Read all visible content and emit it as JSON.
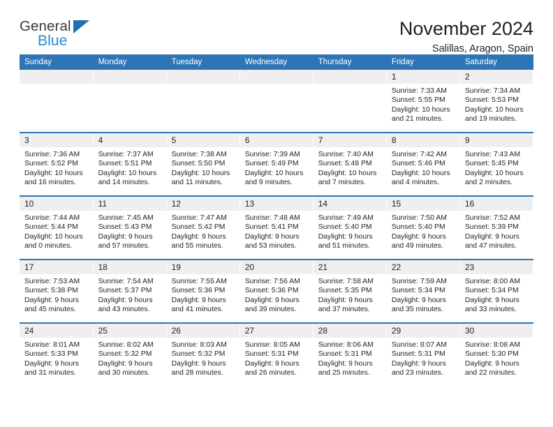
{
  "brand": {
    "name_part1": "General",
    "name_part2": "Blue",
    "triangle_icon": "blue-triangle-icon",
    "accent_color": "#1f8ad6",
    "triangle_color": "#1f6fb5"
  },
  "header": {
    "title": "November 2024",
    "subtitle": "Salillas, Aragon, Spain"
  },
  "theme": {
    "header_row_bg": "#2e75b6",
    "header_row_text": "#ffffff",
    "daynum_bg": "#efefef",
    "cell_bg": "#ffffff",
    "text_color": "#231f20"
  },
  "calendar": {
    "weekday_headers": [
      "Sunday",
      "Monday",
      "Tuesday",
      "Wednesday",
      "Thursday",
      "Friday",
      "Saturday"
    ],
    "weeks": [
      [
        {
          "day": "",
          "sunrise": "",
          "sunset": "",
          "daylight": ""
        },
        {
          "day": "",
          "sunrise": "",
          "sunset": "",
          "daylight": ""
        },
        {
          "day": "",
          "sunrise": "",
          "sunset": "",
          "daylight": ""
        },
        {
          "day": "",
          "sunrise": "",
          "sunset": "",
          "daylight": ""
        },
        {
          "day": "",
          "sunrise": "",
          "sunset": "",
          "daylight": ""
        },
        {
          "day": "1",
          "sunrise": "Sunrise: 7:33 AM",
          "sunset": "Sunset: 5:55 PM",
          "daylight": "Daylight: 10 hours and 21 minutes."
        },
        {
          "day": "2",
          "sunrise": "Sunrise: 7:34 AM",
          "sunset": "Sunset: 5:53 PM",
          "daylight": "Daylight: 10 hours and 19 minutes."
        }
      ],
      [
        {
          "day": "3",
          "sunrise": "Sunrise: 7:36 AM",
          "sunset": "Sunset: 5:52 PM",
          "daylight": "Daylight: 10 hours and 16 minutes."
        },
        {
          "day": "4",
          "sunrise": "Sunrise: 7:37 AM",
          "sunset": "Sunset: 5:51 PM",
          "daylight": "Daylight: 10 hours and 14 minutes."
        },
        {
          "day": "5",
          "sunrise": "Sunrise: 7:38 AM",
          "sunset": "Sunset: 5:50 PM",
          "daylight": "Daylight: 10 hours and 11 minutes."
        },
        {
          "day": "6",
          "sunrise": "Sunrise: 7:39 AM",
          "sunset": "Sunset: 5:49 PM",
          "daylight": "Daylight: 10 hours and 9 minutes."
        },
        {
          "day": "7",
          "sunrise": "Sunrise: 7:40 AM",
          "sunset": "Sunset: 5:48 PM",
          "daylight": "Daylight: 10 hours and 7 minutes."
        },
        {
          "day": "8",
          "sunrise": "Sunrise: 7:42 AM",
          "sunset": "Sunset: 5:46 PM",
          "daylight": "Daylight: 10 hours and 4 minutes."
        },
        {
          "day": "9",
          "sunrise": "Sunrise: 7:43 AM",
          "sunset": "Sunset: 5:45 PM",
          "daylight": "Daylight: 10 hours and 2 minutes."
        }
      ],
      [
        {
          "day": "10",
          "sunrise": "Sunrise: 7:44 AM",
          "sunset": "Sunset: 5:44 PM",
          "daylight": "Daylight: 10 hours and 0 minutes."
        },
        {
          "day": "11",
          "sunrise": "Sunrise: 7:45 AM",
          "sunset": "Sunset: 5:43 PM",
          "daylight": "Daylight: 9 hours and 57 minutes."
        },
        {
          "day": "12",
          "sunrise": "Sunrise: 7:47 AM",
          "sunset": "Sunset: 5:42 PM",
          "daylight": "Daylight: 9 hours and 55 minutes."
        },
        {
          "day": "13",
          "sunrise": "Sunrise: 7:48 AM",
          "sunset": "Sunset: 5:41 PM",
          "daylight": "Daylight: 9 hours and 53 minutes."
        },
        {
          "day": "14",
          "sunrise": "Sunrise: 7:49 AM",
          "sunset": "Sunset: 5:40 PM",
          "daylight": "Daylight: 9 hours and 51 minutes."
        },
        {
          "day": "15",
          "sunrise": "Sunrise: 7:50 AM",
          "sunset": "Sunset: 5:40 PM",
          "daylight": "Daylight: 9 hours and 49 minutes."
        },
        {
          "day": "16",
          "sunrise": "Sunrise: 7:52 AM",
          "sunset": "Sunset: 5:39 PM",
          "daylight": "Daylight: 9 hours and 47 minutes."
        }
      ],
      [
        {
          "day": "17",
          "sunrise": "Sunrise: 7:53 AM",
          "sunset": "Sunset: 5:38 PM",
          "daylight": "Daylight: 9 hours and 45 minutes."
        },
        {
          "day": "18",
          "sunrise": "Sunrise: 7:54 AM",
          "sunset": "Sunset: 5:37 PM",
          "daylight": "Daylight: 9 hours and 43 minutes."
        },
        {
          "day": "19",
          "sunrise": "Sunrise: 7:55 AM",
          "sunset": "Sunset: 5:36 PM",
          "daylight": "Daylight: 9 hours and 41 minutes."
        },
        {
          "day": "20",
          "sunrise": "Sunrise: 7:56 AM",
          "sunset": "Sunset: 5:36 PM",
          "daylight": "Daylight: 9 hours and 39 minutes."
        },
        {
          "day": "21",
          "sunrise": "Sunrise: 7:58 AM",
          "sunset": "Sunset: 5:35 PM",
          "daylight": "Daylight: 9 hours and 37 minutes."
        },
        {
          "day": "22",
          "sunrise": "Sunrise: 7:59 AM",
          "sunset": "Sunset: 5:34 PM",
          "daylight": "Daylight: 9 hours and 35 minutes."
        },
        {
          "day": "23",
          "sunrise": "Sunrise: 8:00 AM",
          "sunset": "Sunset: 5:34 PM",
          "daylight": "Daylight: 9 hours and 33 minutes."
        }
      ],
      [
        {
          "day": "24",
          "sunrise": "Sunrise: 8:01 AM",
          "sunset": "Sunset: 5:33 PM",
          "daylight": "Daylight: 9 hours and 31 minutes."
        },
        {
          "day": "25",
          "sunrise": "Sunrise: 8:02 AM",
          "sunset": "Sunset: 5:32 PM",
          "daylight": "Daylight: 9 hours and 30 minutes."
        },
        {
          "day": "26",
          "sunrise": "Sunrise: 8:03 AM",
          "sunset": "Sunset: 5:32 PM",
          "daylight": "Daylight: 9 hours and 28 minutes."
        },
        {
          "day": "27",
          "sunrise": "Sunrise: 8:05 AM",
          "sunset": "Sunset: 5:31 PM",
          "daylight": "Daylight: 9 hours and 26 minutes."
        },
        {
          "day": "28",
          "sunrise": "Sunrise: 8:06 AM",
          "sunset": "Sunset: 5:31 PM",
          "daylight": "Daylight: 9 hours and 25 minutes."
        },
        {
          "day": "29",
          "sunrise": "Sunrise: 8:07 AM",
          "sunset": "Sunset: 5:31 PM",
          "daylight": "Daylight: 9 hours and 23 minutes."
        },
        {
          "day": "30",
          "sunrise": "Sunrise: 8:08 AM",
          "sunset": "Sunset: 5:30 PM",
          "daylight": "Daylight: 9 hours and 22 minutes."
        }
      ]
    ]
  }
}
